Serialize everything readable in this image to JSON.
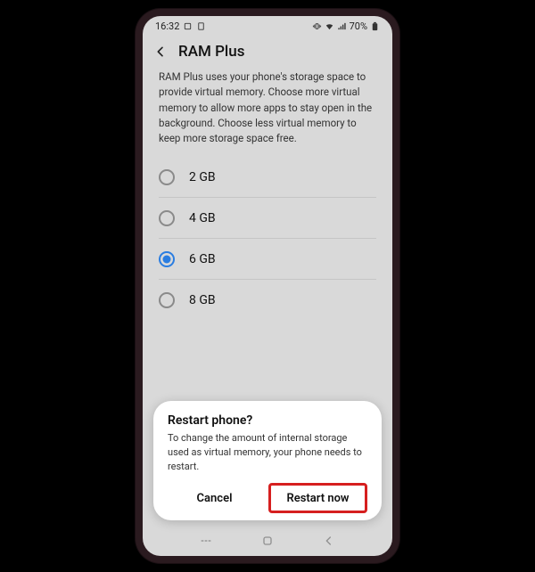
{
  "status": {
    "time": "16:32",
    "battery": "70%"
  },
  "header": {
    "title": "RAM Plus"
  },
  "description": "RAM Plus uses your phone's storage space to provide virtual memory. Choose more virtual memory to allow more apps to stay open in the background. Choose less virtual memory to keep more storage space free.",
  "options": [
    {
      "label": "2 GB",
      "selected": false
    },
    {
      "label": "4 GB",
      "selected": false
    },
    {
      "label": "6 GB",
      "selected": true
    },
    {
      "label": "8 GB",
      "selected": false
    }
  ],
  "dialog": {
    "title": "Restart phone?",
    "body": "To change the amount of internal storage used as virtual memory, your phone needs to restart.",
    "cancel": "Cancel",
    "confirm": "Restart now"
  }
}
